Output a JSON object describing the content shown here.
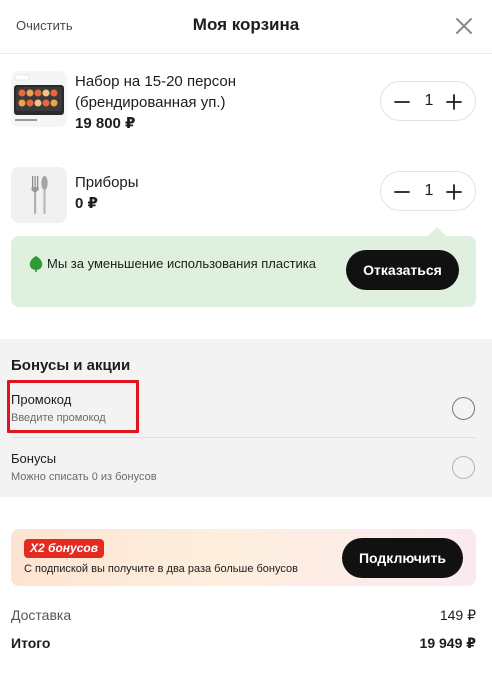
{
  "header": {
    "clear_label": "Очистить",
    "title": "Моя корзина",
    "close_icon": "close-icon"
  },
  "items": [
    {
      "name_line1": "Набор на 15-20 персон",
      "name_line2": "(брендированная уп.)",
      "price": "19 800 ₽",
      "quantity": "1"
    },
    {
      "name_line1": "Приборы",
      "name_line2": "",
      "price": "0 ₽",
      "quantity": "1"
    }
  ],
  "eco_banner": {
    "text": "Мы за уменьшение использования пластика",
    "button_label": "Отказаться",
    "icon": "leaf-icon"
  },
  "bonuses": {
    "title": "Бонусы и акции",
    "promo_label": "Промокод",
    "promo_placeholder": "Введите промокод",
    "bonus_label": "Бонусы",
    "bonus_sub": "Можно списать 0 из бонусов"
  },
  "subscription": {
    "badge": "X2 бонусов",
    "text": "С подпиской вы получите в два раза больше бонусов",
    "button_label": "Подключить"
  },
  "summary": {
    "delivery_label": "Доставка",
    "delivery_value": "149 ₽",
    "total_label": "Итого",
    "total_value": "19 949 ₽"
  },
  "colors": {
    "accent_dark": "#111111",
    "eco_bg": "#dff0de",
    "badge_red": "#e32b22",
    "highlight_red": "#e0141e"
  }
}
